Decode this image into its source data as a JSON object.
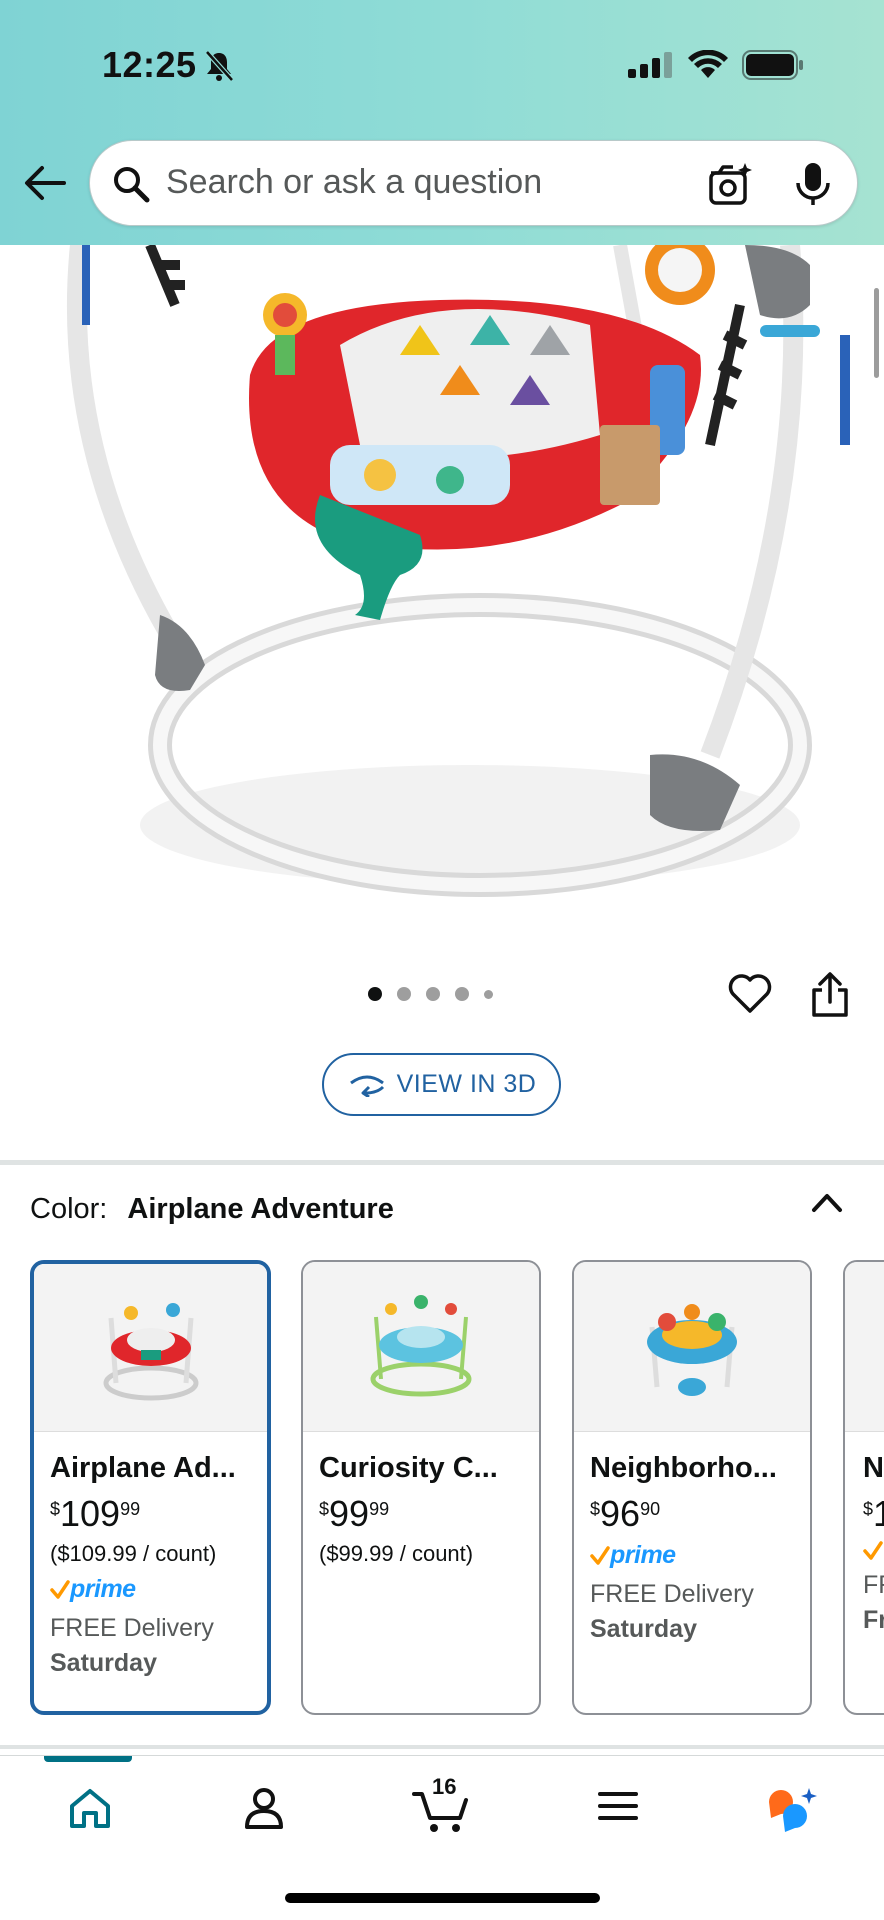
{
  "status_bar": {
    "time": "12:25"
  },
  "search": {
    "placeholder": "Search or ask a question"
  },
  "gallery": {
    "total_images": 5,
    "active_index": 0
  },
  "view3d": {
    "label": "VIEW IN 3D"
  },
  "color": {
    "label": "Color:",
    "selected_name": "Airplane Adventure"
  },
  "variants": [
    {
      "title": "Airplane Ad...",
      "price_symbol": "$",
      "price_whole": "109",
      "price_fraction": "99",
      "unit_price": "($109.99 / count)",
      "prime": "prime",
      "delivery": "FREE Delivery",
      "delivery_day": "Saturday",
      "selected": true
    },
    {
      "title": "Curiosity C...",
      "price_symbol": "$",
      "price_whole": "99",
      "price_fraction": "99",
      "unit_price": "($99.99 / count)",
      "selected": false
    },
    {
      "title": "Neighborho...",
      "price_symbol": "$",
      "price_whole": "96",
      "price_fraction": "90",
      "prime": "prime",
      "delivery": "FREE Delivery",
      "delivery_day": "Saturday",
      "selected": false
    },
    {
      "title": "N",
      "price_symbol": "$",
      "price_whole": "1",
      "delivery": "FR",
      "delivery_day": "Fr",
      "selected": false
    }
  ],
  "bottom_nav": {
    "items": [
      "home-icon",
      "account-icon",
      "cart-icon",
      "menu-icon",
      "rufus-icon"
    ],
    "cart_count": "16"
  },
  "colors": {
    "accent": "#2162a1",
    "teal": "#007185",
    "prime_blue": "#1a98ff",
    "prime_check": "#ff9900"
  }
}
